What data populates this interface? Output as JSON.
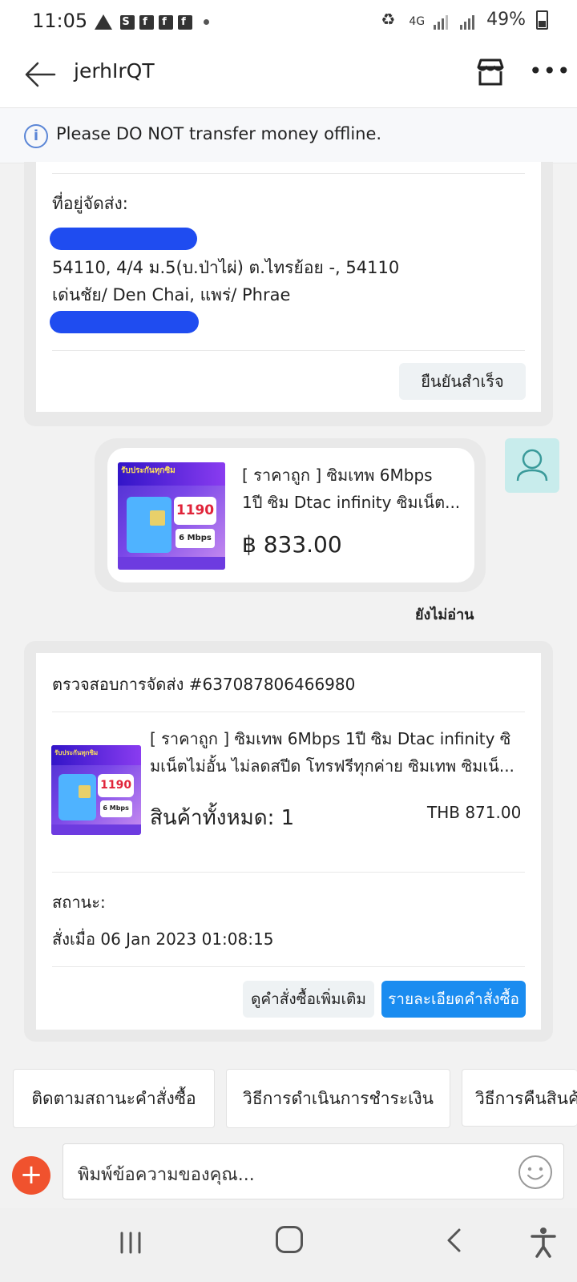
{
  "status_bar": {
    "time": "11:05",
    "network": "4G",
    "battery": "49%"
  },
  "header": {
    "title": "jerhIrQT",
    "back_icon": "arrow-left-icon",
    "shop_icon": "store-icon",
    "more_icon": "more-horizontal-icon"
  },
  "notice": {
    "icon": "info-icon",
    "text": "Please DO NOT transfer money offline."
  },
  "address_card": {
    "label": "ที่อยู่จัดส่ง:",
    "line1": "54110, 4/4 ม.5(บ.ป่าไผ่) ต.ไทรย้อย -, 54110",
    "line2": "เด่นชัย/ Den Chai, แพร่/ Phrae",
    "confirm_button": "ยืนยันสำเร็จ"
  },
  "product_message": {
    "title_line1": "[ ราคาถูก  ] ซิมเทพ 6Mbps",
    "title_line2": "1ปี ซิม Dtac infinity ซิมเน็ต...",
    "price": "฿ 833.00",
    "read_status": "ยังไม่อ่าน",
    "image_banner": "รับประกันทุกซิม",
    "image_price": "1190",
    "image_speed": "6 Mbps"
  },
  "order_card": {
    "title": "ตรวจสอบการจัดส่ง #637087806466980",
    "product_line1": "[ ราคาถูก  ] ซิมเทพ 6Mbps 1ปี ซิม Dtac infinity ซิ",
    "product_line2": "มเน็ตไม่อั้น ไม่ลดสปีด โทรฟรีทุกค่าย ซิมเทพ ซิมเน็...",
    "quantity": "สินค้าทั้งหมด: 1",
    "price": "THB 871.00",
    "status_label": "สถานะ:",
    "ordered_at": "สั่งเมื่อ 06 Jan 2023  01:08:15",
    "more_orders_button": "ดูคำสั่งซื้อเพิ่มเติม",
    "details_button": "รายละเอียดคำสั่งซื้อ"
  },
  "quick_replies": [
    "ติดตามสถานะคำสั่งซื้อ",
    "วิธีการดำเนินการชำระเงิน",
    "วิธีการคืนสินค้า"
  ],
  "input": {
    "placeholder": "พิมพ์ข้อความของคุณ..."
  },
  "colors": {
    "accent_blue": "#1a8cf0",
    "add_button": "#f0522e",
    "avatar_bg": "#c8ecec",
    "info_blue": "#5b86d6"
  }
}
